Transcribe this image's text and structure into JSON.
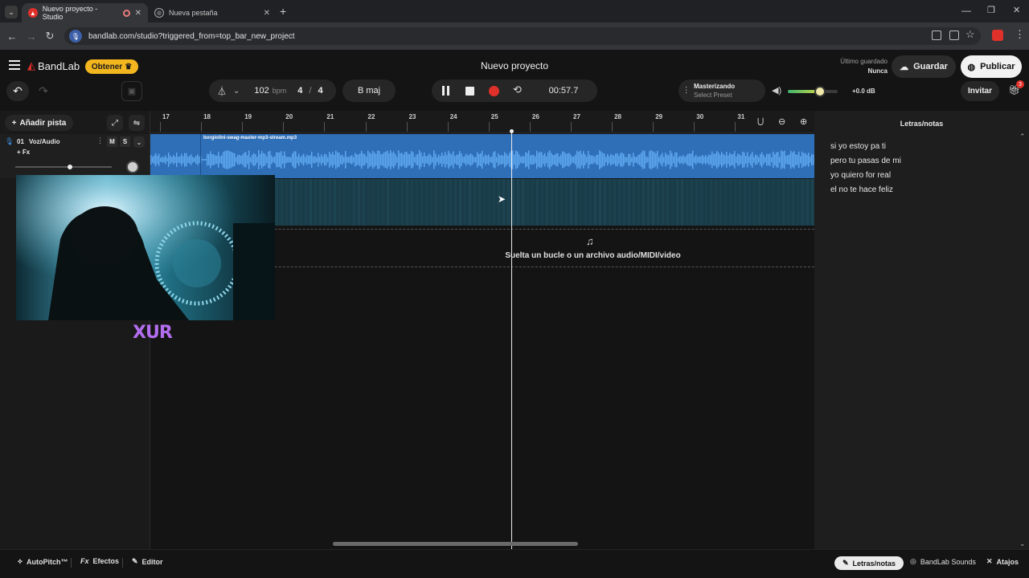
{
  "browser": {
    "tabs": [
      {
        "title": "Nuevo proyecto - Studio"
      },
      {
        "title": "Nueva pestaña"
      }
    ],
    "url": "bandlab.com/studio?triggered_from=top_bar_new_project"
  },
  "header": {
    "brand": "BandLab",
    "obtener": "Obtener",
    "project_title": "Nuevo proyecto",
    "saved_label": "Último guardado",
    "saved_value": "Nunca",
    "save_btn": "Guardar",
    "publish_btn": "Publicar",
    "invite_btn": "Invitar",
    "notif_count": "3"
  },
  "transport": {
    "bpm": "102",
    "bpm_unit": "bpm",
    "sig_num": "4",
    "sig_sep": "/",
    "sig_den": "4",
    "key": "B maj",
    "time": "00:57.7",
    "mastering_label": "Masterizando",
    "mastering_preset": "Select Preset",
    "volume_db": "+0.0 dB",
    "volume_level": 0.65
  },
  "tracks": {
    "add_label": "Añadir pista",
    "track1_num": "01",
    "track1_name": "Voz/Audio",
    "mute": "M",
    "solo": "S",
    "fx": "+ Fx",
    "clip_name": "borgiolini-swag-master-mp3-stream.mp3"
  },
  "ruler": [
    "17",
    "18",
    "19",
    "20",
    "21",
    "22",
    "23",
    "24",
    "25",
    "26",
    "27",
    "28",
    "29",
    "30",
    "31"
  ],
  "drop_text": "Suelta un bucle o un archivo audio/MIDI/video",
  "overlay_logo": "XUR",
  "side": {
    "title": "Letras/notas",
    "lyrics": [
      "si yo estoy pa ti",
      "pero tu pasas de mi",
      "yo quiero for real",
      "el no te hace feliz"
    ]
  },
  "bottom": {
    "autopitch": "AutoPitch™",
    "efectos": "Efectos",
    "editor": "Editor",
    "letras": "Letras/notas",
    "sounds": "BandLab Sounds",
    "atajos": "Atajos"
  },
  "colors": {
    "accent": "#f3b61f",
    "clip": "#2f6fb8",
    "record": "#e0302a"
  }
}
